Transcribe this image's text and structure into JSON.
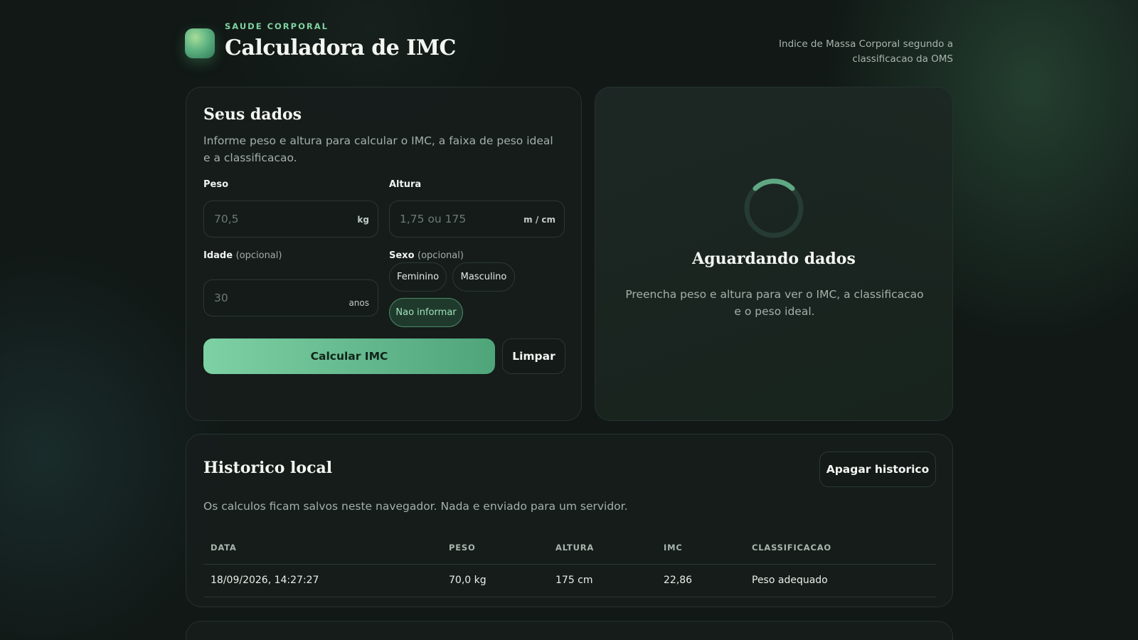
{
  "header": {
    "eyebrow": "SAUDE CORPORAL",
    "title": "Calculadora de IMC",
    "subtitle": "Indice de Massa Corporal segundo a classificacao da OMS"
  },
  "form": {
    "title": "Seus dados",
    "description": "Informe peso e altura para calcular o IMC, a faixa de peso ideal e a classificacao.",
    "peso": {
      "label": "Peso",
      "placeholder": "70,5",
      "value": "",
      "unit": "kg"
    },
    "altura": {
      "label": "Altura",
      "placeholder": "1,75 ou 175",
      "value": "",
      "unit": "m / cm"
    },
    "idade": {
      "label": "Idade",
      "optional": "(opcional)",
      "placeholder": "30",
      "value": "",
      "unit": "anos"
    },
    "sexo": {
      "label": "Sexo",
      "optional": "(opcional)",
      "options": [
        "Feminino",
        "Masculino",
        "Nao informar"
      ],
      "selected": "Nao informar"
    },
    "calculate_label": "Calcular IMC",
    "clear_label": "Limpar"
  },
  "result": {
    "title": "Aguardando dados",
    "description": "Preencha peso e altura para ver o IMC, a classificacao e o peso ideal."
  },
  "history": {
    "title": "Historico local",
    "clear_label": "Apagar historico",
    "description": "Os calculos ficam salvos neste navegador. Nada e enviado para um servidor.",
    "columns": [
      "DATA",
      "PESO",
      "ALTURA",
      "IMC",
      "CLASSIFICACAO"
    ],
    "rows": [
      [
        "18/09/2026, 14:27:27",
        "70,0 kg",
        "175 cm",
        "22,86",
        "Peso adequado"
      ]
    ]
  },
  "colors": {
    "accent": "#7fd3a0",
    "button_gradient_start": "#7dd1a4",
    "button_gradient_end": "#4fa47a",
    "background": "#111816"
  },
  "icons": {
    "logo": "app-logo-gradient-square",
    "spinner": "loading-spinner-icon"
  }
}
